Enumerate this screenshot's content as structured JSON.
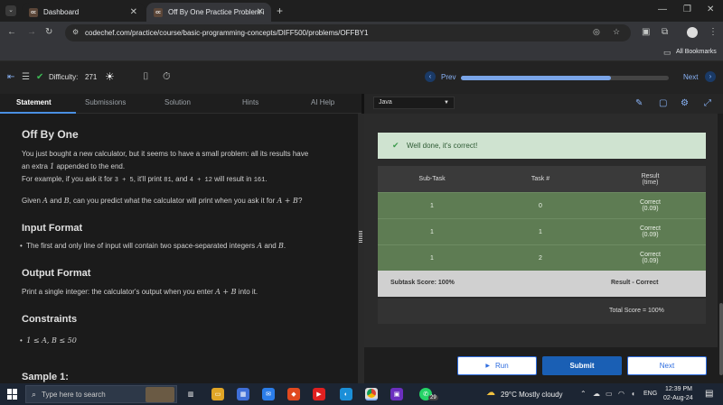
{
  "browser": {
    "tabs": [
      {
        "favicon": "cc",
        "title": "Dashboard"
      },
      {
        "favicon": "cc",
        "title": "Off By One Practice Problem in"
      }
    ],
    "url": "codechef.com/practice/course/basic-programming-concepts/DIFF500/problems/OFFBY1",
    "bookmarks_label": "All Bookmarks"
  },
  "toolbar": {
    "difficulty_label": "Difficulty:",
    "difficulty_value": "271",
    "prev_label": "Prev",
    "next_label": "Next",
    "progress_fraction": 0.72
  },
  "problem_tabs": [
    "Statement",
    "Submissions",
    "Solution",
    "Hints",
    "AI Help"
  ],
  "statement": {
    "title": "Off By One",
    "intro_1": "You just bought a new calculator, but it seems to have a small problem: all its results have",
    "intro_2_pre": "an extra ",
    "intro_2_math": "1",
    "intro_2_post": " appended to the end.",
    "example_pre": "For example, if you ask it for ",
    "example_code_1": "3 + 5",
    "example_mid_1": ", it'll print ",
    "example_code_2": "81",
    "example_mid_2": ", and ",
    "example_code_3": "4 + 12",
    "example_mid_3": " will result in ",
    "example_code_4": "161",
    "example_end": ".",
    "given_pre": "Given ",
    "given_a": "A",
    "given_and": " and ",
    "given_b": "B",
    "given_post": ", can you predict what the calculator will print when you ask it for ",
    "given_expr": "A + B",
    "given_q": "?",
    "input_heading": "Input Format",
    "input_text": "The first and only line of input will contain two space-separated integers ",
    "input_a": "A",
    "input_and": " and ",
    "input_b": "B",
    "input_end": ".",
    "output_heading": "Output Format",
    "output_pre": "Print a single integer: the calculator's output when you enter ",
    "output_expr": "A + B",
    "output_post": " into it.",
    "constraints_heading": "Constraints",
    "constraint": "1 ≤ A, B ≤ 50",
    "sample_heading": "Sample 1:"
  },
  "editor": {
    "language": "Java"
  },
  "result": {
    "success_message": "Well done, it's correct!",
    "headers": [
      "Sub-Task",
      "Task #",
      "Result",
      "(time)"
    ],
    "rows": [
      {
        "subtask": "1",
        "task": "0",
        "result": "Correct",
        "time": "(0.09)"
      },
      {
        "subtask": "1",
        "task": "1",
        "result": "Correct",
        "time": "(0.09)"
      },
      {
        "subtask": "1",
        "task": "2",
        "result": "Correct",
        "time": "(0.09)"
      }
    ],
    "subtask_score": "Subtask Score: 100%",
    "subtask_result": "Result - Correct",
    "total_score": "Total Score = 100%"
  },
  "actions": {
    "run_label": "Run",
    "submit_label": "Submit",
    "next_label": "Next"
  },
  "taskbar": {
    "search_placeholder": "Type here to search",
    "weather": "29°C  Mostly cloudy",
    "language": "ENG",
    "time": "12:39 PM",
    "date": "02-Aug-24",
    "whatsapp_badge": "29"
  },
  "colors": {
    "accent_blue": "#1a5fb4",
    "success_bg": "#cfe3d0",
    "row_green": "#5e7c53"
  }
}
